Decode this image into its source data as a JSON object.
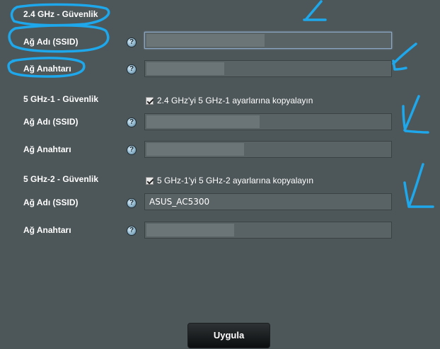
{
  "sections": [
    {
      "title": "2.4 GHz - Güvenlik",
      "ssid_label": "Ağ Adı (SSID)",
      "key_label": "Ağ Anahtarı",
      "ssid_value": "",
      "key_value": ""
    },
    {
      "title": "5 GHz-1 - Güvenlik",
      "copy_label": "2.4 GHz'yi 5 GHz-1 ayarlarına kopyalayın",
      "copy_checked": true,
      "ssid_label": "Ağ Adı (SSID)",
      "key_label": "Ağ Anahtarı",
      "ssid_value": "",
      "key_value": ""
    },
    {
      "title": "5 GHz-2 - Güvenlik",
      "copy_label": "5 GHz-1'yi 5 GHz-2 ayarlarına kopyalayın",
      "copy_checked": true,
      "ssid_label": "Ağ Adı (SSID)",
      "key_label": "Ağ Anahtarı",
      "ssid_value": "ASUS_AC5300",
      "key_value": ""
    }
  ],
  "help_glyph": "?",
  "apply_label": "Uygula",
  "annotation_color": "#1ea7ea"
}
